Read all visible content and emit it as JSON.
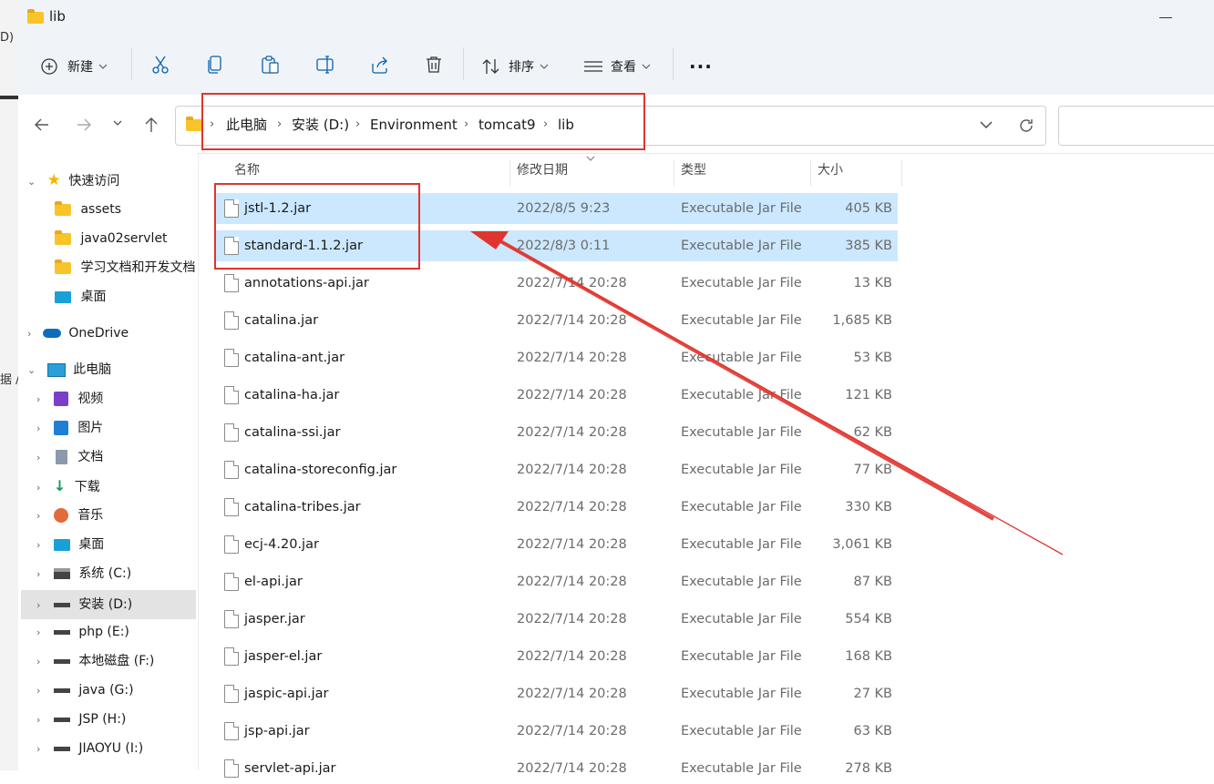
{
  "window": {
    "title": "lib"
  },
  "background_text": {
    "top": "D)",
    "side": "据 /"
  },
  "toolbar": {
    "new_label": "新建",
    "sort_label": "排序",
    "view_label": "查看",
    "more_label": "..."
  },
  "address": {
    "crumbs": [
      "此电脑",
      "安装 (D:)",
      "Environment",
      "tomcat9",
      "lib"
    ]
  },
  "columns": {
    "name": "名称",
    "modified": "修改日期",
    "type": "类型",
    "size": "大小"
  },
  "sidebar": {
    "quick_access": "快速访问",
    "quick_items": [
      "assets",
      "java02servlet",
      "学习文档和开发文档",
      "桌面"
    ],
    "onedrive": "OneDrive",
    "this_pc": "此电脑",
    "pc_items": [
      "视频",
      "图片",
      "文档",
      "下载",
      "音乐",
      "桌面",
      "系统 (C:)",
      "安装 (D:)",
      "php (E:)",
      "本地磁盘 (F:)",
      "java (G:)",
      "JSP (H:)",
      "JIAOYU (I:)"
    ]
  },
  "files": [
    {
      "name": "jstl-1.2.jar",
      "date": "2022/8/5 9:23",
      "type": "Executable Jar File",
      "size": "405 KB",
      "selected": true
    },
    {
      "name": "standard-1.1.2.jar",
      "date": "2022/8/3 0:11",
      "type": "Executable Jar File",
      "size": "385 KB",
      "selected": true
    },
    {
      "name": "annotations-api.jar",
      "date": "2022/7/14 20:28",
      "type": "Executable Jar File",
      "size": "13 KB"
    },
    {
      "name": "catalina.jar",
      "date": "2022/7/14 20:28",
      "type": "Executable Jar File",
      "size": "1,685 KB"
    },
    {
      "name": "catalina-ant.jar",
      "date": "2022/7/14 20:28",
      "type": "Executable Jar File",
      "size": "53 KB"
    },
    {
      "name": "catalina-ha.jar",
      "date": "2022/7/14 20:28",
      "type": "Executable Jar File",
      "size": "121 KB"
    },
    {
      "name": "catalina-ssi.jar",
      "date": "2022/7/14 20:28",
      "type": "Executable Jar File",
      "size": "62 KB"
    },
    {
      "name": "catalina-storeconfig.jar",
      "date": "2022/7/14 20:28",
      "type": "Executable Jar File",
      "size": "77 KB"
    },
    {
      "name": "catalina-tribes.jar",
      "date": "2022/7/14 20:28",
      "type": "Executable Jar File",
      "size": "330 KB"
    },
    {
      "name": "ecj-4.20.jar",
      "date": "2022/7/14 20:28",
      "type": "Executable Jar File",
      "size": "3,061 KB"
    },
    {
      "name": "el-api.jar",
      "date": "2022/7/14 20:28",
      "type": "Executable Jar File",
      "size": "87 KB"
    },
    {
      "name": "jasper.jar",
      "date": "2022/7/14 20:28",
      "type": "Executable Jar File",
      "size": "554 KB"
    },
    {
      "name": "jasper-el.jar",
      "date": "2022/7/14 20:28",
      "type": "Executable Jar File",
      "size": "168 KB"
    },
    {
      "name": "jaspic-api.jar",
      "date": "2022/7/14 20:28",
      "type": "Executable Jar File",
      "size": "27 KB"
    },
    {
      "name": "jsp-api.jar",
      "date": "2022/7/14 20:28",
      "type": "Executable Jar File",
      "size": "63 KB"
    },
    {
      "name": "servlet-api.jar",
      "date": "2022/7/14 20:28",
      "type": "Executable Jar File",
      "size": "278 KB"
    }
  ],
  "colors": {
    "selection": "#cce8ff",
    "annotation_red": "#e0342e",
    "chrome_bg": "#f0f4f9"
  }
}
